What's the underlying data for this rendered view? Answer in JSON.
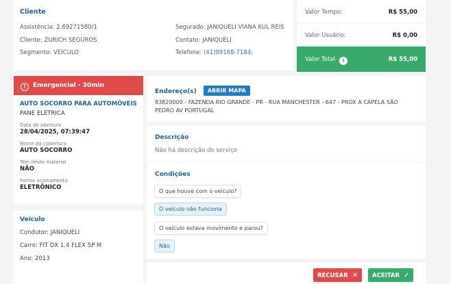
{
  "client": {
    "title": "Cliente",
    "assistencia": "Assistência: 2.69271580/1",
    "cliente": "Cliente: ZURICH SEGUROS",
    "segmento": "Segmento: VEÍCULO",
    "segurado": "Segurado: JANIQUELI VIANA KUL REIS",
    "contato": "Contato: JANIQUELI",
    "telefone_label": "Telefone:",
    "telefone": "(41)99168-7184;"
  },
  "values": {
    "tempo_label": "Valor Tempo:",
    "tempo_value": "R$ 55,00",
    "usuario_label": "Valor Usuário:",
    "usuario_value": "R$ 0,00",
    "total_label": "Valor Total",
    "total_value": "R$ 55,00"
  },
  "alert": {
    "text": "Emergencial - 30min"
  },
  "service": {
    "title": "AUTO SOCORRO PARA AUTOMÓVEIS",
    "subtitle": "PANE ELÉTRICA",
    "fields": [
      {
        "label": "Data de abertura",
        "value": "28/04/2025, 07:39:47"
      },
      {
        "label": "Nome da cobertura",
        "value": "AUTO SOCORRO"
      },
      {
        "label": "Tem limite material",
        "value": "NÃO"
      },
      {
        "label": "Forma acionamento",
        "value": "ELETRÔNICO"
      }
    ]
  },
  "vehicle": {
    "title": "Veículo",
    "condutor": "Condutor: JANIQUELI",
    "carro": "Carro: FIT DX 1.4 FLEX 5P M",
    "ano": "Ano: 2013"
  },
  "address": {
    "title": "Endereço(s)",
    "map_button": "ABRIR MAPA",
    "text": "83820000 - FAZENDA RIO GRANDE - PR - RUA MANCHESTER - 647 - PROX A CAPELA SÃO PEDRO AV PORTUGAL"
  },
  "description": {
    "title": "Descrição",
    "text": "Não há descrição do serviço"
  },
  "conditions": {
    "title": "Condições",
    "q1": "O que houve com o veículo?",
    "a1": "O veículo não funciona",
    "q2": "O veículo estava movimento e parou?",
    "a2": "Não"
  },
  "actions": {
    "refuse": "RECUSAR",
    "accept": "ACEITAR"
  },
  "colors": {
    "accent_blue": "#1f5f9e",
    "danger": "#e04a4a",
    "success": "#3aaa6c"
  }
}
